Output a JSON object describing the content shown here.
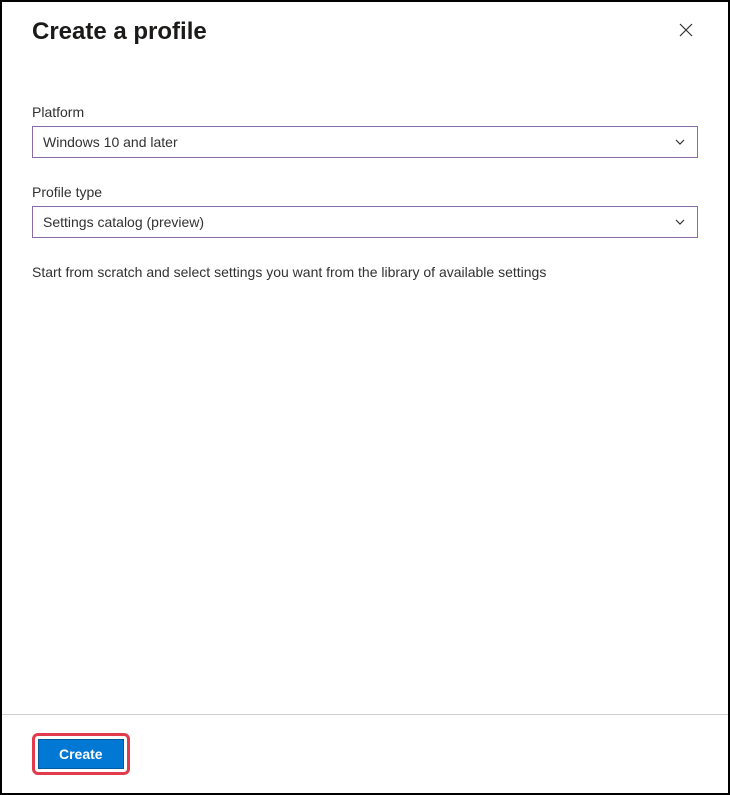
{
  "header": {
    "title": "Create a profile"
  },
  "form": {
    "platform": {
      "label": "Platform",
      "value": "Windows 10 and later"
    },
    "profileType": {
      "label": "Profile type",
      "value": "Settings catalog (preview)"
    },
    "description": "Start from scratch and select settings you want from the library of available settings"
  },
  "footer": {
    "createLabel": "Create"
  }
}
